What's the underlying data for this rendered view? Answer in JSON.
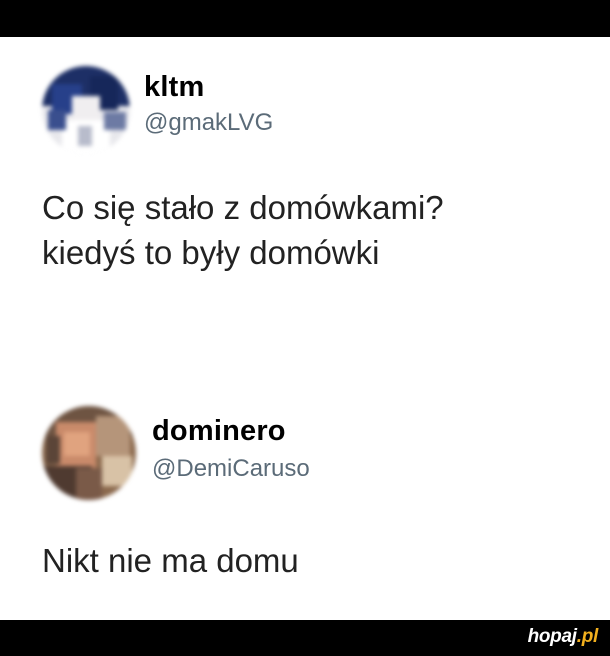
{
  "posts": [
    {
      "display_name": "kltm",
      "handle": "@gmakLVG",
      "text_lines": [
        "Co się stało z domówkami?",
        "kiedyś to były domówki"
      ],
      "avatar_icon": "blurred-avatar-photo"
    },
    {
      "display_name": "dominero",
      "handle": "@DemiCaruso",
      "text_lines": [
        "Nikt nie ma domu"
      ],
      "avatar_icon": "blurred-avatar-photo"
    }
  ],
  "watermark": {
    "main": "hopaj",
    "suffix": ".pl"
  },
  "colors": {
    "bars": "#000000",
    "background": "#ffffff",
    "handle": "#5b6b78",
    "watermark_accent": "#f2b01e"
  }
}
